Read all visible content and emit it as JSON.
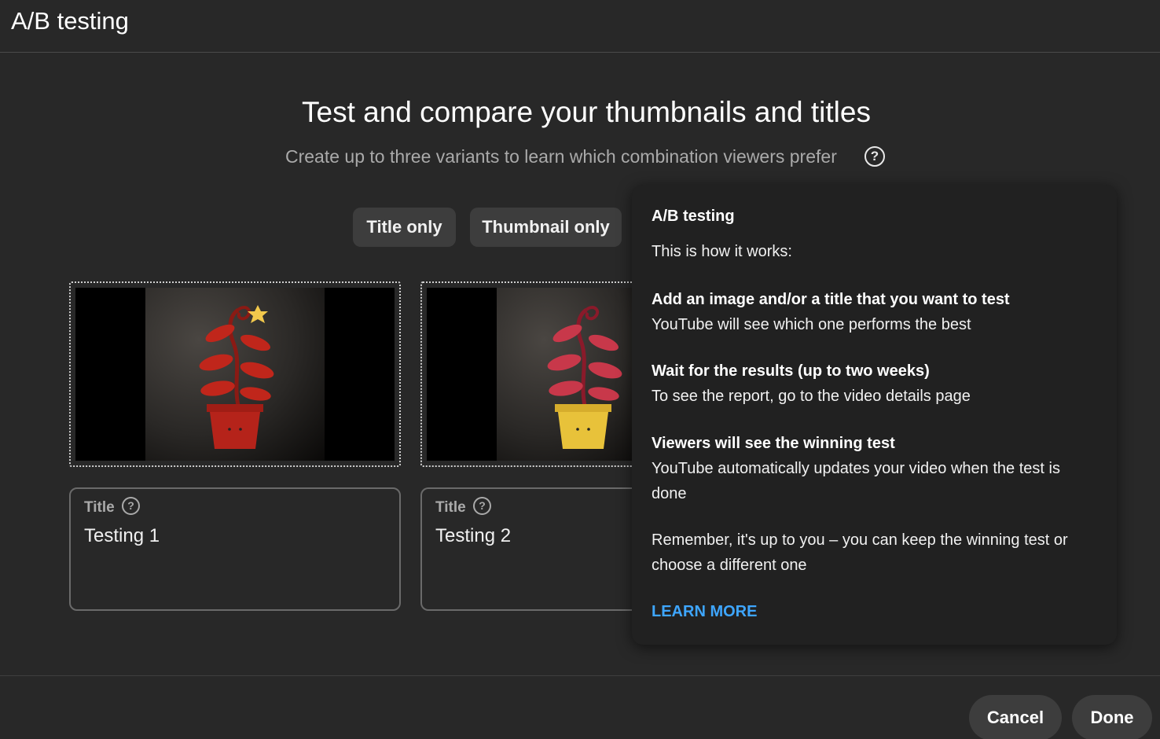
{
  "header": {
    "title": "A/B testing"
  },
  "main": {
    "headline": "Test and compare your thumbnails and titles",
    "subtitle": "Create up to three variants to learn which combination viewers prefer",
    "help_glyph": "?",
    "chips": [
      {
        "label": "Title only"
      },
      {
        "label": "Thumbnail only"
      }
    ]
  },
  "variants": [
    {
      "title_label": "Title",
      "title_value": "Testing 1",
      "pot_color": "#b5231a"
    },
    {
      "title_label": "Title",
      "title_value": "Testing 2",
      "pot_color": "#e8c23a"
    }
  ],
  "popover": {
    "title": "A/B testing",
    "intro": "This is how it works:",
    "steps": [
      {
        "head": "Add an image and/or a title that you want to test",
        "body": "YouTube will see which one performs the best"
      },
      {
        "head": "Wait for the results (up to two weeks)",
        "body": "To see the report, go to the video details page"
      },
      {
        "head": "Viewers will see the winning test",
        "body": "YouTube automatically updates your video when the test is done"
      }
    ],
    "remember": "Remember, it's up to you – you can keep the winning test or choose a different one",
    "learn_more": "LEARN MORE"
  },
  "footer": {
    "cancel_label": "Cancel",
    "done_label": "Done"
  },
  "colors": {
    "background": "#282828",
    "popover": "#212121",
    "chip": "#3d3d3d",
    "link": "#3ea6ff"
  }
}
